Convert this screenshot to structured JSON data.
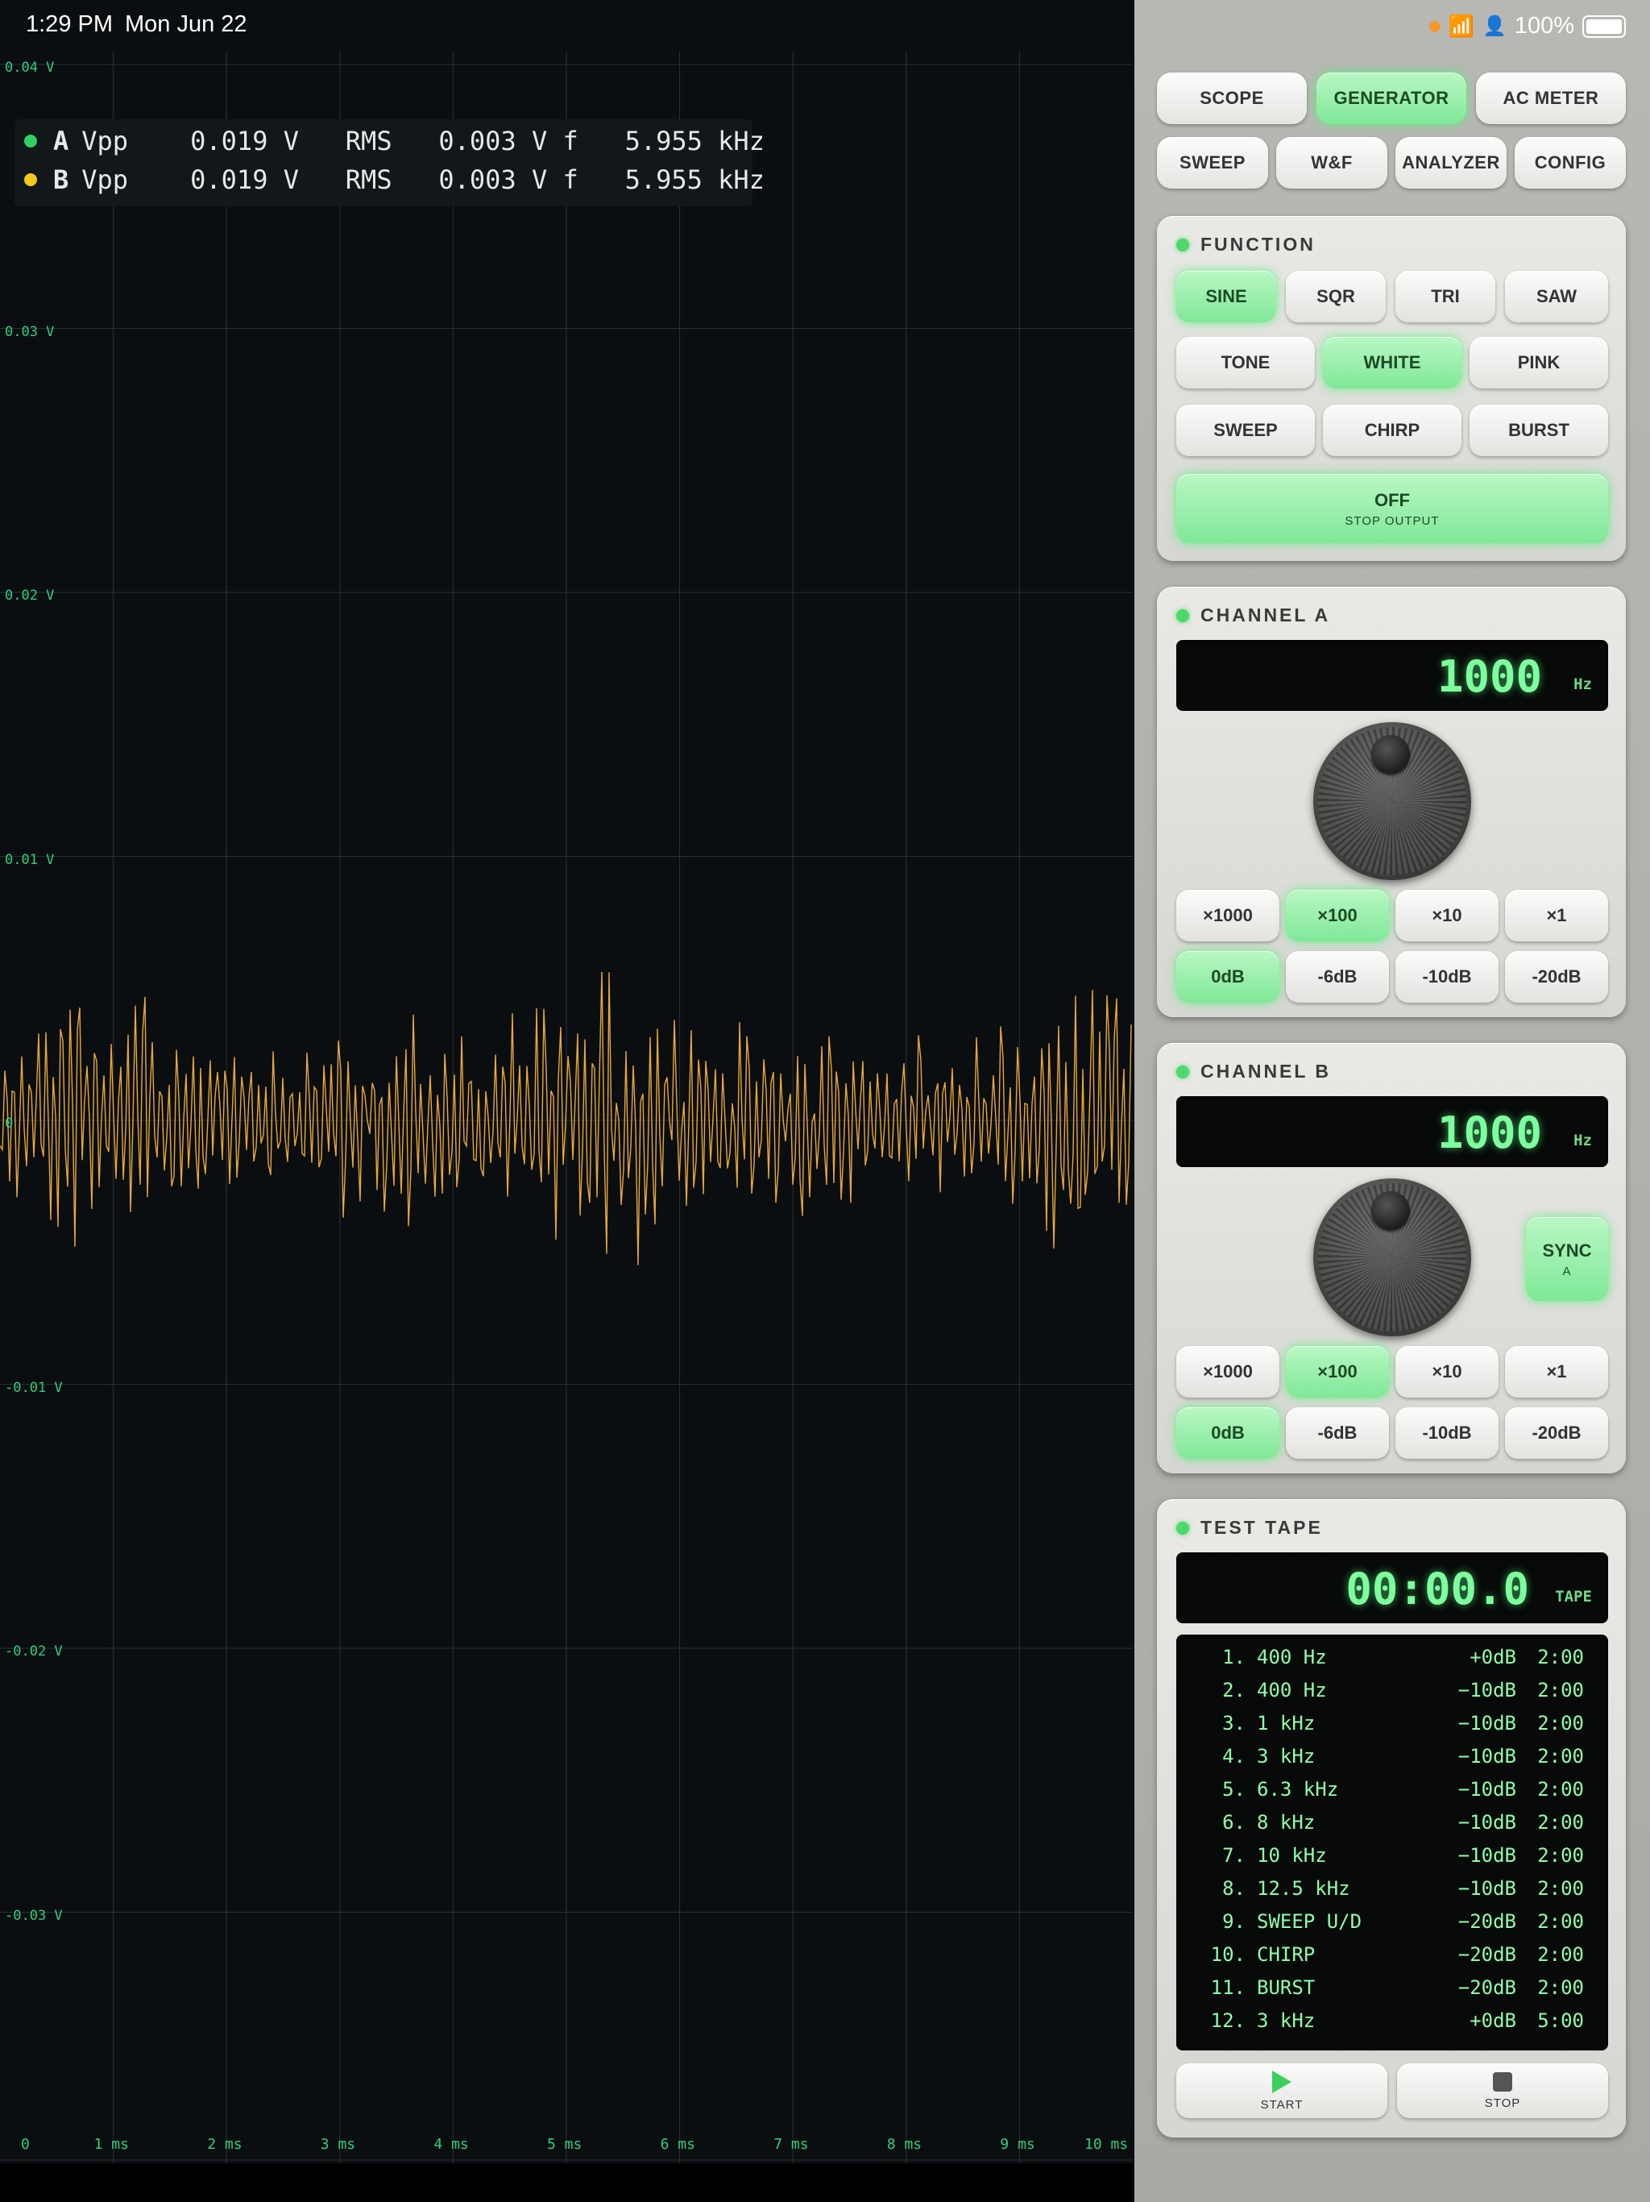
{
  "status": {
    "time": "1:29 PM",
    "date": "Mon Jun 22",
    "battery": "100%"
  },
  "scope": {
    "y_labels": [
      "0.04 V",
      "0.03 V",
      "0.02 V",
      "0.01 V",
      "0",
      "-0.01 V",
      "-0.02 V",
      "-0.03 V"
    ],
    "x_labels": [
      "0",
      "1 ms",
      "2 ms",
      "3 ms",
      "4 ms",
      "5 ms",
      "6 ms",
      "7 ms",
      "8 ms",
      "9 ms",
      "10 ms"
    ],
    "trace_color": "#e8a83a",
    "grid_color": "#2a3034",
    "readout": [
      {
        "channel": "A",
        "color": "#2fd062",
        "vpp_label": "Vpp",
        "vpp": "0.019 V",
        "rms_label": "RMS",
        "rms": "0.003 V",
        "f_label": "f",
        "f": "5.955 kHz"
      },
      {
        "channel": "B",
        "color": "#f2c81a",
        "vpp_label": "Vpp",
        "vpp": "0.019 V",
        "rms_label": "RMS",
        "rms": "0.003 V",
        "f_label": "f",
        "f": "5.955 kHz"
      }
    ]
  },
  "nav": {
    "row1": [
      "SCOPE",
      "GENERATOR",
      "AC METER"
    ],
    "row2": [
      "SWEEP",
      "W&F",
      "ANALYZER",
      "CONFIG"
    ],
    "active": "GENERATOR"
  },
  "function": {
    "title": "FUNCTION",
    "row1": [
      "SINE",
      "SQR",
      "TRI",
      "SAW"
    ],
    "row2": [
      "TONE",
      "WHITE",
      "PINK"
    ],
    "row3": [
      "SWEEP",
      "CHIRP",
      "BURST"
    ],
    "active": [
      "SINE",
      "WHITE"
    ],
    "off_label": "OFF",
    "off_sub": "STOP OUTPUT"
  },
  "channel_a": {
    "title": "CHANNEL A",
    "freq": "1000",
    "unit": "Hz",
    "multipliers": [
      "×1000",
      "×100",
      "×10",
      "×1"
    ],
    "levels": [
      "0dB",
      "-6dB",
      "-10dB",
      "-20dB"
    ],
    "active_multiplier": "×100",
    "active_level": "0dB"
  },
  "channel_b": {
    "title": "CHANNEL B",
    "freq": "1000",
    "unit": "Hz",
    "sync_label": "SYNC",
    "sync_sub": "A",
    "multipliers": [
      "×1000",
      "×100",
      "×10",
      "×1"
    ],
    "levels": [
      "0dB",
      "-6dB",
      "-10dB",
      "-20dB"
    ],
    "active_multiplier": "×100",
    "active_level": "0dB"
  },
  "test_tape": {
    "title": "TEST TAPE",
    "time": "00:00.0",
    "unit": "TAPE",
    "tracks": [
      {
        "num": "1.",
        "name": "400 Hz",
        "level": "+0dB",
        "dur": "2:00"
      },
      {
        "num": "2.",
        "name": "400 Hz",
        "level": "−10dB",
        "dur": "2:00"
      },
      {
        "num": "3.",
        "name": "1 kHz",
        "level": "−10dB",
        "dur": "2:00"
      },
      {
        "num": "4.",
        "name": "3 kHz",
        "level": "−10dB",
        "dur": "2:00"
      },
      {
        "num": "5.",
        "name": "6.3 kHz",
        "level": "−10dB",
        "dur": "2:00"
      },
      {
        "num": "6.",
        "name": "8 kHz",
        "level": "−10dB",
        "dur": "2:00"
      },
      {
        "num": "7.",
        "name": "10 kHz",
        "level": "−10dB",
        "dur": "2:00"
      },
      {
        "num": "8.",
        "name": "12.5 kHz",
        "level": "−10dB",
        "dur": "2:00"
      },
      {
        "num": "9.",
        "name": "SWEEP U/D",
        "level": "−20dB",
        "dur": "2:00"
      },
      {
        "num": "10.",
        "name": "CHIRP",
        "level": "−20dB",
        "dur": "2:00"
      },
      {
        "num": "11.",
        "name": "BURST",
        "level": "−20dB",
        "dur": "2:00"
      },
      {
        "num": "12.",
        "name": "3 kHz",
        "level": "+0dB",
        "dur": "5:00"
      }
    ],
    "start_label": "START",
    "stop_label": "STOP"
  }
}
